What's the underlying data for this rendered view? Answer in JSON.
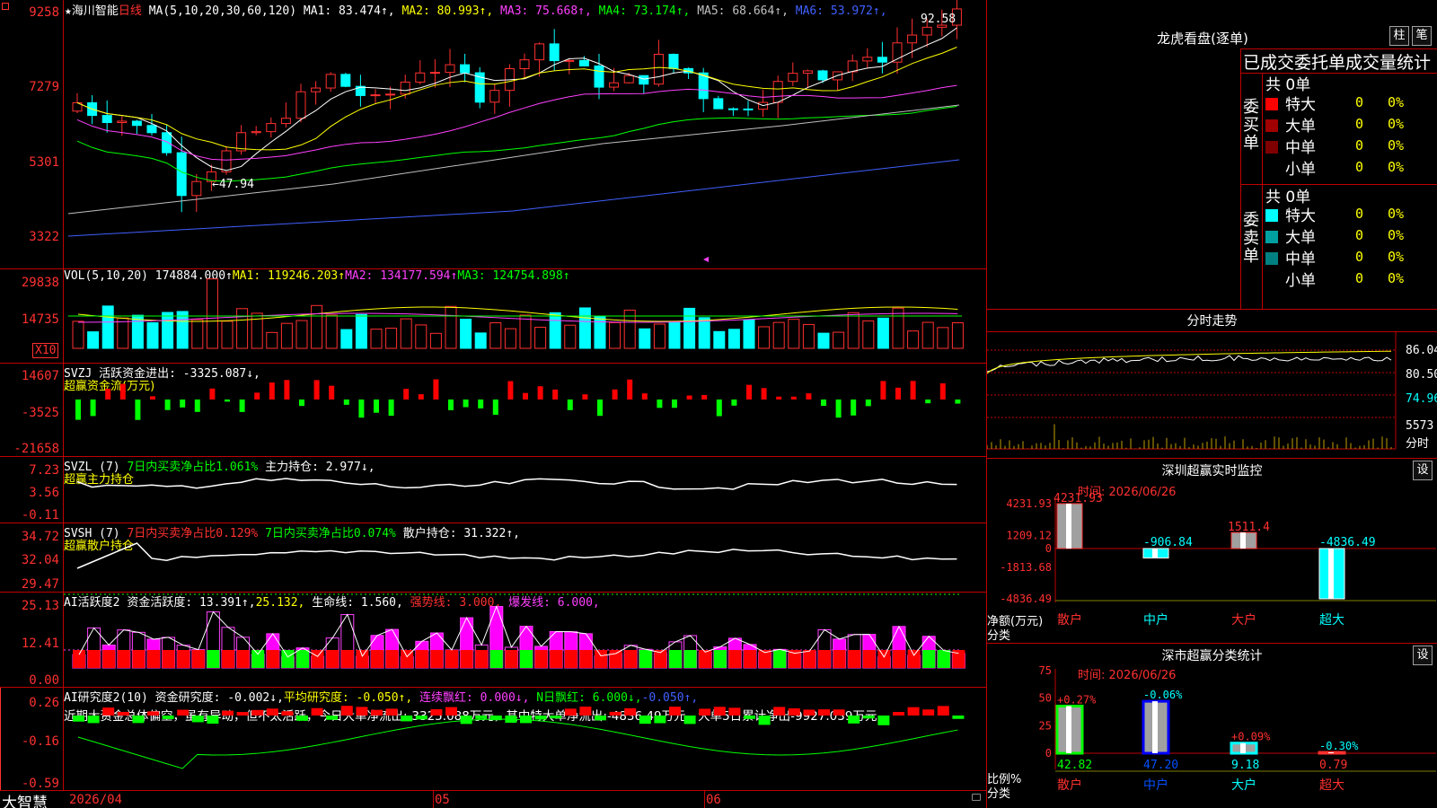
{
  "title_bar": {
    "star": "★",
    "stock_name": "海川智能",
    "period": "日线"
  },
  "main_chart": {
    "ma_params": "MA(5,10,20,30,60,120)",
    "ma": [
      {
        "label": "MA1: 83.474↑",
        "color": "#ffffff"
      },
      {
        "label": "MA2: 80.993↑",
        "color": "#ffff00"
      },
      {
        "label": "MA3: 75.668↑",
        "color": "#ff40ff"
      },
      {
        "label": "MA4: 73.174↑",
        "color": "#00ff00"
      },
      {
        "label": "MA5: 68.664↑",
        "color": "#c0c0c0"
      },
      {
        "label": "MA6: 53.972↑",
        "color": "#4060ff"
      }
    ],
    "y_labels": [
      "9258",
      "7279",
      "5301",
      "3322"
    ],
    "high_note": "92.58",
    "low_note": "47.94"
  },
  "vol_panel": {
    "params": "VOL(5,10,20)",
    "value": "174884.000↑",
    "ma1": "MA1: 119246.203↑",
    "ma2": "MA2: 134177.594↑",
    "ma3": "MA3: 124754.898↑",
    "y_labels": [
      "29838",
      "14735"
    ],
    "unit": "X10"
  },
  "svzj": {
    "name": "SVZJ",
    "text": "活跃资金进出: -3325.087↓,",
    "sub": "超赢资金流(万元)",
    "y_labels": [
      "14607",
      "-3525",
      "-21658"
    ]
  },
  "svzl": {
    "name": "SVZL (7)",
    "t1": "7日内买卖净占比1.061%",
    "t2": "主力持仓: 2.977↓,",
    "sub": "超赢主力持仓",
    "y_labels": [
      "7.23",
      "3.56",
      "-0.11"
    ]
  },
  "svsh": {
    "name": "SVSH (7)",
    "t1": "7日内买卖净占比0.129%",
    "t2": "7日内买卖净占比0.074%",
    "t3": "散户持仓: 31.322↑,",
    "sub": "超赢散户持仓",
    "y_labels": [
      "34.72",
      "32.04",
      "29.47"
    ]
  },
  "ai_active": {
    "name": "AI活跃度2",
    "t1": "资金活跃度: 13.391↑,",
    "t2": "25.132,",
    "t3": "生命线: 1.560,",
    "t4": "强势线: 3.000,",
    "t5": "爆发线: 6.000,",
    "y_labels": [
      "25.13",
      "12.41",
      "0.00"
    ]
  },
  "ai_research": {
    "name": "AI研究度2(10)",
    "t1": "资金研究度: -0.002↓,",
    "t2": "平均研究度: -0.050↑,",
    "t3": "连续飘红: 0.000↓,",
    "t4": "N日飘红: 6.000↓,",
    "t5": "-0.050↑,",
    "comment": "近期大资金总体偏空，虽有异动，但不太活跃，今日大单净流出:-3325.088万元，其中特大单净流出:-4836.49万元，大单5日累计净出-9927.039万元，",
    "y_labels": [
      "0.26",
      "-0.16",
      "-0.59"
    ]
  },
  "bottom_bar": {
    "app": "大智慧",
    "dates": [
      "2026/04",
      "05",
      "06"
    ]
  },
  "dragon_tiger": {
    "title": "龙虎看盘(逐单)",
    "btn_bar": "柱",
    "btn_pen": "笔",
    "header": "已成交委托单成交量统计",
    "buy_label": "委买单",
    "sell_label": "委卖单",
    "buy_total": "共 0单",
    "sell_total": "共 0单",
    "buy_rows": [
      {
        "name": "特大",
        "count": "0",
        "pct": "0%",
        "color": "#ff0000"
      },
      {
        "name": "大单",
        "count": "0",
        "pct": "0%",
        "color": "#a00000"
      },
      {
        "name": "中单",
        "count": "0",
        "pct": "0%",
        "color": "#800000"
      },
      {
        "name": "小单",
        "count": "0",
        "pct": "0%",
        "color": ""
      }
    ],
    "sell_rows": [
      {
        "name": "特大",
        "count": "0",
        "pct": "0%",
        "color": "#00ffff"
      },
      {
        "name": "大单",
        "count": "0",
        "pct": "0%",
        "color": "#00a0a0"
      },
      {
        "name": "中单",
        "count": "0",
        "pct": "0%",
        "color": "#008080"
      },
      {
        "name": "小单",
        "count": "0",
        "pct": "0%",
        "color": ""
      }
    ]
  },
  "intraday": {
    "title": "分时走势",
    "y_labels": [
      "86.04",
      "80.50",
      "74.96"
    ],
    "vol_label": "5573",
    "vol_unit": "分时"
  },
  "sz_monitor": {
    "title": "深圳超赢实时监控",
    "btn": "设",
    "time": "时间: 2026/06/26",
    "y_labels": [
      "4231.93",
      "1209.12",
      "0",
      "-1813.68",
      "-4836.49"
    ],
    "axis_unit": "净额(万元)",
    "axis_cat": "分类",
    "categories": [
      "散户",
      "中户",
      "大户",
      "超大"
    ],
    "values": [
      4231.93,
      -906.84,
      1511.4,
      -4836.49
    ],
    "value_labels": [
      "4231.93",
      "-906.84",
      "1511.4",
      "-4836.49"
    ]
  },
  "sz_classify": {
    "title": "深市超赢分类统计",
    "btn": "设",
    "time": "时间: 2026/06/26",
    "y_labels": [
      "75",
      "50",
      "25",
      "0"
    ],
    "axis_unit": "比例%",
    "axis_cat": "分类",
    "categories": [
      "散户",
      "中户",
      "大户",
      "超大"
    ],
    "values": [
      42.82,
      47.2,
      9.18,
      0.79
    ],
    "value_labels": [
      "42.82",
      "47.20",
      "9.18",
      "0.79"
    ],
    "change_labels": [
      "+0.27%",
      "-0.06%",
      "+0.09%",
      "-0.30%"
    ]
  }
}
